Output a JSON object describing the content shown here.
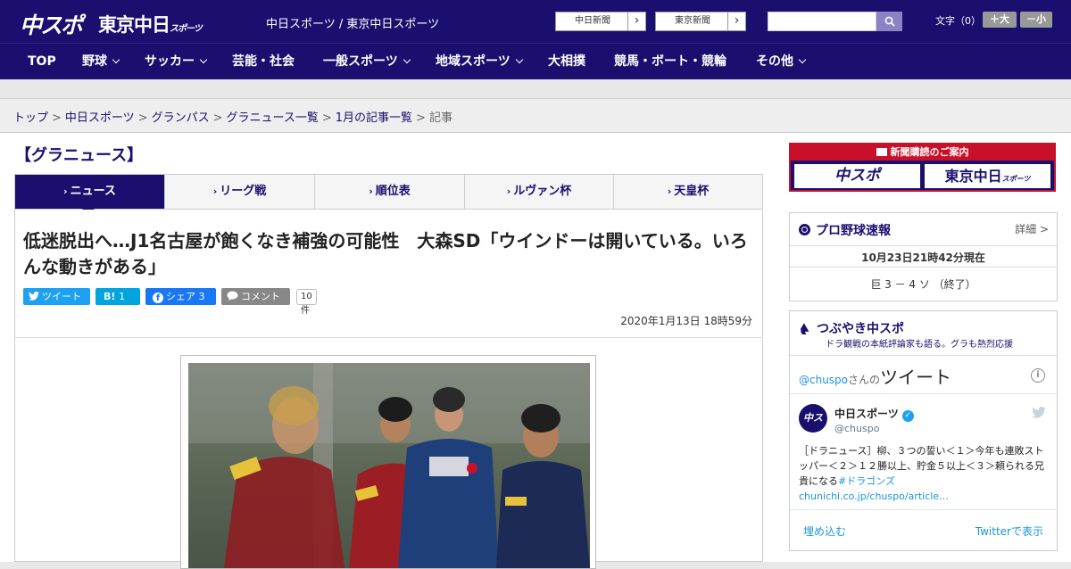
{
  "header": {
    "logo_chuspo": "中スポ",
    "logo_tokyo": "東京中日",
    "logo_tokyo_small": "スポーツ",
    "site_names": "中日スポーツ / 東京中日スポーツ",
    "paper_buttons": [
      {
        "label": "中日新聞",
        "arrow": "›"
      },
      {
        "label": "東京新聞",
        "arrow": "›"
      }
    ],
    "search_placeholder": "",
    "font_size_label": "文字（0）",
    "font_plus": "＋大",
    "font_minus": "－小"
  },
  "nav": {
    "items": [
      {
        "label": "TOP"
      },
      {
        "label": "野球"
      },
      {
        "label": "サッカー"
      },
      {
        "label": "芸能・社会"
      },
      {
        "label": "一般スポーツ"
      },
      {
        "label": "地域スポーツ"
      },
      {
        "label": "大相撲"
      },
      {
        "label": "競馬・ボート・競輪"
      },
      {
        "label": "その他"
      }
    ]
  },
  "breadcrumb": {
    "items": [
      "トップ",
      "中日スポーツ",
      "グランパス",
      "グラニュース一覧",
      "1月の記事一覧"
    ],
    "current": "記事",
    "separator": ">"
  },
  "section": {
    "heading": "【グラニュース】"
  },
  "tabs": [
    {
      "label": "ニュース",
      "active": true
    },
    {
      "label": "リーグ戦",
      "active": false
    },
    {
      "label": "順位表",
      "active": false
    },
    {
      "label": "ルヴァン杯",
      "active": false
    },
    {
      "label": "天皇杯",
      "active": false
    }
  ],
  "article": {
    "headline": "低迷脱出へ…J1名古屋が飽くなき補強の可能性　大森SD「ウインドーは開いている。いろんな動きがある」",
    "share": {
      "tweet": "ツイート",
      "hatena": "B!",
      "hatena_count": "1",
      "facebook": "シェア",
      "facebook_count": "3",
      "comment": "コメント",
      "comment_count": "10件"
    },
    "date": "2020年1月13日 18時59分"
  },
  "sidebar": {
    "promo": {
      "title": "新聞購読のご案内",
      "logo1": "中スポ",
      "logo2": "東京中日",
      "logo2_small": "スポーツ"
    },
    "baseball": {
      "title": "プロ野球速報",
      "detail": "詳細 >",
      "updated": "10月23日21時42分現在",
      "score": "巨 3 － 4 ソ （終了）"
    },
    "twitter": {
      "title": "つぶやき中スポ",
      "subtitle": "ドラ観戦の本紙評論家も語る。グラも熱烈応援",
      "handle_prefix": "@chuspo",
      "handle_suffix": "さんの",
      "tweets_word": "ツイート",
      "account_name": "中日スポーツ",
      "account_handle": "@chuspo",
      "avatar_text": "中スポ",
      "tweet_text": "［ドラニュース］柳、３つの誓い＜１＞今年も連敗ストッパー＜２＞１２勝以上、貯金５以上＜３＞頼られる兄貴になる",
      "hashtag": "#ドラゴンズ",
      "link": "chunichi.co.jp/chuspo/article…",
      "embed": "埋め込む",
      "view_on": "Twitterで表示"
    }
  },
  "colors": {
    "brand_navy": "#1a0f6e",
    "accent_red": "#c9102a",
    "twitter_blue": "#1da1f2",
    "facebook_blue": "#1877f2"
  }
}
